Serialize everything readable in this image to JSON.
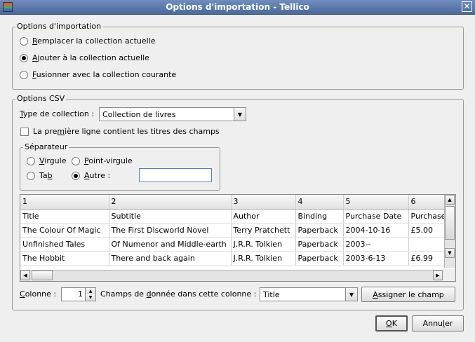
{
  "window": {
    "title": "Options d'importation - Tellico",
    "close_glyph": "✕"
  },
  "import_options": {
    "legend": "Options d'importation",
    "options": [
      {
        "prefix": "",
        "mnemonic": "R",
        "rest": "emplacer la collection actuelle",
        "checked": false
      },
      {
        "prefix": "",
        "mnemonic": "A",
        "rest": "jouter à la collection actuelle",
        "checked": true
      },
      {
        "prefix": "",
        "mnemonic": "F",
        "rest": "usionner avec la collection courante",
        "checked": false
      }
    ]
  },
  "csv_options": {
    "legend": "Options CSV",
    "collection_type": {
      "prefix": "",
      "mnemonic": "T",
      "rest": "ype de collection :",
      "value": "Collection de livres"
    },
    "header_checkbox": {
      "prefix": "La pre",
      "mnemonic": "m",
      "rest": "ière ligne contient les titres des champs",
      "checked": false
    },
    "separator": {
      "legend": "Séparateur",
      "options": [
        {
          "prefix": "",
          "mnemonic": "V",
          "rest": "irgule",
          "checked": false
        },
        {
          "prefix": "",
          "mnemonic": "P",
          "rest": "oint-virgule",
          "checked": false
        },
        {
          "prefix": "Ta",
          "mnemonic": "b",
          "rest": "",
          "checked": false
        },
        {
          "prefix": "",
          "mnemonic": "A",
          "rest": "utre :",
          "checked": true
        }
      ],
      "other_value": ""
    },
    "table": {
      "columns": [
        "1",
        "2",
        "3",
        "4",
        "5",
        "6"
      ],
      "rows": [
        [
          "Title",
          "Subtitle",
          "Author",
          "Binding",
          "Purchase Date",
          "Purchase"
        ],
        [
          "The Colour Of Magic",
          "The First Discworld Novel",
          "Terry Pratchett",
          "Paperback",
          "2004-10-16",
          "£5.00"
        ],
        [
          "Unfinished Tales",
          "Of Numenor and Middle-earth",
          "J.R.R. Tolkien",
          "Paperback",
          "2003--",
          ""
        ],
        [
          "The Hobbit",
          "There and back again",
          "J.R.R. Tolkien",
          "Paperback",
          "2003-6-13",
          "£6.99"
        ]
      ]
    },
    "column": {
      "prefix": "",
      "mnemonic": "C",
      "rest": "olonne :",
      "value": "1"
    },
    "field": {
      "prefix": "Champs de ",
      "mnemonic": "d",
      "rest": "onnée dans cette colonne :",
      "value": "Title"
    },
    "assign_button": {
      "prefix": "",
      "mnemonic": "A",
      "rest": "ssigner le champ"
    }
  },
  "footer": {
    "ok": {
      "prefix": "",
      "mnemonic": "O",
      "rest": "K"
    },
    "cancel": {
      "prefix": "Annu",
      "mnemonic": "l",
      "rest": "er"
    }
  }
}
